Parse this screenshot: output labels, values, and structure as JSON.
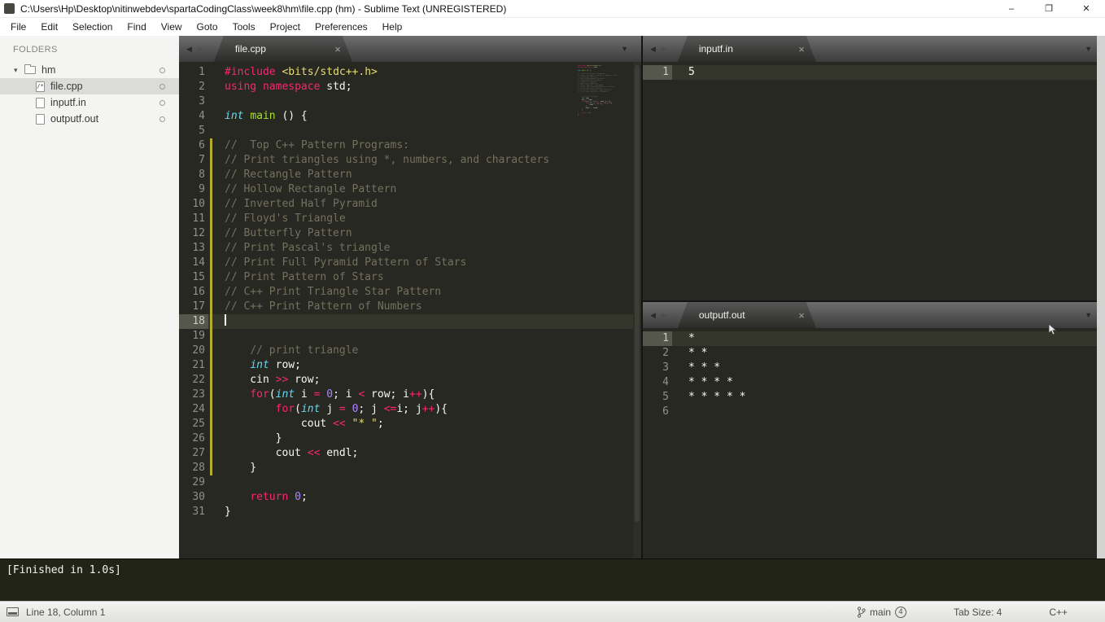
{
  "window": {
    "title": "C:\\Users\\Hp\\Desktop\\nitinwebdev\\spartaCodingClass\\week8\\hm\\file.cpp (hm) - Sublime Text (UNREGISTERED)"
  },
  "icons": {
    "minimize": "–",
    "restore": "❐",
    "close": "✕",
    "tab_close": "×",
    "overflow_menu": "▼",
    "nav_back": "◀",
    "nav_forward": "▶",
    "folder_caret": "▾"
  },
  "menu": {
    "items": [
      "File",
      "Edit",
      "Selection",
      "Find",
      "View",
      "Goto",
      "Tools",
      "Project",
      "Preferences",
      "Help"
    ]
  },
  "sidebar": {
    "heading": "FOLDERS",
    "folder": {
      "name": "hm"
    },
    "files": [
      {
        "name": "file.cpp",
        "badge": "/*"
      },
      {
        "name": "inputf.in"
      },
      {
        "name": "outputf.out"
      }
    ]
  },
  "panes": {
    "editor": {
      "tab": "file.cpp",
      "active_line": 18,
      "modified_range": [
        6,
        28
      ],
      "lines": [
        {
          "num": 1,
          "t": [
            [
              "k",
              "#include"
            ],
            [
              "p",
              " "
            ],
            [
              "s",
              "<bits/stdc++.h>"
            ]
          ]
        },
        {
          "num": 2,
          "t": [
            [
              "k",
              "using"
            ],
            [
              "p",
              " "
            ],
            [
              "k",
              "namespace"
            ],
            [
              "p",
              " std;"
            ]
          ]
        },
        {
          "num": 3,
          "t": []
        },
        {
          "num": 4,
          "t": [
            [
              "t",
              "int"
            ],
            [
              "p",
              " "
            ],
            [
              "f",
              "main"
            ],
            [
              "p",
              " () {"
            ]
          ]
        },
        {
          "num": 5,
          "t": []
        },
        {
          "num": 6,
          "t": [
            [
              "c",
              "//  Top C++ Pattern Programs:"
            ]
          ]
        },
        {
          "num": 7,
          "t": [
            [
              "c",
              "// Print triangles using *, numbers, and characters"
            ]
          ]
        },
        {
          "num": 8,
          "t": [
            [
              "c",
              "// Rectangle Pattern"
            ]
          ]
        },
        {
          "num": 9,
          "t": [
            [
              "c",
              "// Hollow Rectangle Pattern"
            ]
          ]
        },
        {
          "num": 10,
          "t": [
            [
              "c",
              "// Inverted Half Pyramid"
            ]
          ]
        },
        {
          "num": 11,
          "t": [
            [
              "c",
              "// Floyd's Triangle"
            ]
          ]
        },
        {
          "num": 12,
          "t": [
            [
              "c",
              "// Butterfly Pattern"
            ]
          ]
        },
        {
          "num": 13,
          "t": [
            [
              "c",
              "// Print Pascal's triangle"
            ]
          ]
        },
        {
          "num": 14,
          "t": [
            [
              "c",
              "// Print Full Pyramid Pattern of Stars"
            ]
          ]
        },
        {
          "num": 15,
          "t": [
            [
              "c",
              "// Print Pattern of Stars"
            ]
          ]
        },
        {
          "num": 16,
          "t": [
            [
              "c",
              "// C++ Print Triangle Star Pattern"
            ]
          ]
        },
        {
          "num": 17,
          "t": [
            [
              "c",
              "// C++ Print Pattern of Numbers"
            ]
          ]
        },
        {
          "num": 18,
          "t": []
        },
        {
          "num": 19,
          "t": []
        },
        {
          "num": 20,
          "t": [
            [
              "p",
              "    "
            ],
            [
              "c",
              "// print triangle"
            ]
          ]
        },
        {
          "num": 21,
          "t": [
            [
              "p",
              "    "
            ],
            [
              "t",
              "int"
            ],
            [
              "p",
              " row;"
            ]
          ]
        },
        {
          "num": 22,
          "t": [
            [
              "p",
              "    cin "
            ],
            [
              "k",
              ">>"
            ],
            [
              "p",
              " row;"
            ]
          ]
        },
        {
          "num": 23,
          "t": [
            [
              "p",
              "    "
            ],
            [
              "k",
              "for"
            ],
            [
              "p",
              "("
            ],
            [
              "t",
              "int"
            ],
            [
              "p",
              " i "
            ],
            [
              "k",
              "="
            ],
            [
              "p",
              " "
            ],
            [
              "n",
              "0"
            ],
            [
              "p",
              "; i "
            ],
            [
              "k",
              "<"
            ],
            [
              "p",
              " row; i"
            ],
            [
              "k",
              "++"
            ],
            [
              "p",
              "){"
            ]
          ]
        },
        {
          "num": 24,
          "t": [
            [
              "p",
              "        "
            ],
            [
              "k",
              "for"
            ],
            [
              "p",
              "("
            ],
            [
              "t",
              "int"
            ],
            [
              "p",
              " j "
            ],
            [
              "k",
              "="
            ],
            [
              "p",
              " "
            ],
            [
              "n",
              "0"
            ],
            [
              "p",
              "; j "
            ],
            [
              "k",
              "<="
            ],
            [
              "p",
              "i; j"
            ],
            [
              "k",
              "++"
            ],
            [
              "p",
              "){"
            ]
          ]
        },
        {
          "num": 25,
          "t": [
            [
              "p",
              "            cout "
            ],
            [
              "k",
              "<<"
            ],
            [
              "p",
              " "
            ],
            [
              "s",
              "\"* \""
            ],
            [
              "p",
              ";"
            ]
          ]
        },
        {
          "num": 26,
          "t": [
            [
              "p",
              "        }"
            ]
          ]
        },
        {
          "num": 27,
          "t": [
            [
              "p",
              "        cout "
            ],
            [
              "k",
              "<<"
            ],
            [
              "p",
              " endl;"
            ]
          ]
        },
        {
          "num": 28,
          "t": [
            [
              "p",
              "    }"
            ]
          ]
        },
        {
          "num": 29,
          "t": []
        },
        {
          "num": 30,
          "t": [
            [
              "p",
              "    "
            ],
            [
              "k",
              "return"
            ],
            [
              "p",
              " "
            ],
            [
              "n",
              "0"
            ],
            [
              "p",
              ";"
            ]
          ]
        },
        {
          "num": 31,
          "t": [
            [
              "p",
              "}"
            ]
          ]
        }
      ]
    },
    "input": {
      "tab": "inputf.in",
      "active_line": 1,
      "lines": [
        {
          "num": 1,
          "t": [
            [
              "p",
              "5"
            ]
          ]
        }
      ]
    },
    "output": {
      "tab": "outputf.out",
      "active_line": 1,
      "lines": [
        {
          "num": 1,
          "t": [
            [
              "p",
              "*"
            ]
          ]
        },
        {
          "num": 2,
          "t": [
            [
              "p",
              "* *"
            ]
          ]
        },
        {
          "num": 3,
          "t": [
            [
              "p",
              "* * *"
            ]
          ]
        },
        {
          "num": 4,
          "t": [
            [
              "p",
              "* * * *"
            ]
          ]
        },
        {
          "num": 5,
          "t": [
            [
              "p",
              "* * * * *"
            ]
          ]
        },
        {
          "num": 6,
          "t": []
        }
      ]
    }
  },
  "build": {
    "text": "[Finished in 1.0s]"
  },
  "statusbar": {
    "position": "Line 18, Column 1",
    "branch": "main",
    "branch_badge": "4",
    "tab_size": "Tab Size: 4",
    "syntax": "C++"
  },
  "colors": {
    "editor_bg": "#272822",
    "keyword": "#f92672",
    "type": "#66d9ef",
    "function": "#a6e22e",
    "string": "#e6db74",
    "comment": "#75715e",
    "number": "#ae81ff",
    "text": "#f8f8f2",
    "gutter": "#8f908a",
    "modified_marker": "#b5ab2e"
  }
}
